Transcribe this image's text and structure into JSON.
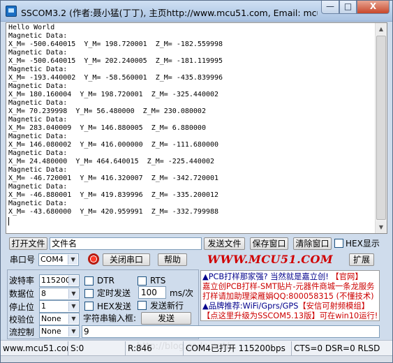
{
  "window": {
    "title": "SSCOM3.2 (作者:聂小猛(丁丁), 主页http://www.mcu51.com, Email: mcu5",
    "minimize_label": "—",
    "maximize_label": "□",
    "close_label": "X"
  },
  "terminal": {
    "lines": [
      "Hello World",
      "Magnetic Data:",
      "X_M= -500.640015  Y_M= 198.720001  Z_M= -182.559998",
      "Magnetic Data:",
      "X_M= -500.640015  Y_M= 202.240005  Z_M= -181.119995",
      "Magnetic Data:",
      "X_M= -193.440002  Y_M= -58.560001  Z_M= -435.839996",
      "Magnetic Data:",
      "X_M= 180.160004  Y_M= 198.720001  Z_M= -325.440002",
      "Magnetic Data:",
      "X_M= 70.239998  Y_M= 56.480000  Z_M= 230.080002",
      "Magnetic Data:",
      "X_M= 283.040009  Y_M= 146.880005  Z_M= 6.880000",
      "Magnetic Data:",
      "X_M= 146.080002  Y_M= 416.000000  Z_M= -111.680000",
      "Magnetic Data:",
      "X_M= 24.480000  Y_M= 464.640015  Z_M= -225.440002",
      "Magnetic Data:",
      "X_M= -46.720001  Y_M= 416.320007  Z_M= -342.720001",
      "Magnetic Data:",
      "X_M= -46.880001  Y_M= 419.839996  Z_M= -335.200012",
      "Magnetic Data:",
      "X_M= -43.680000  Y_M= 420.959991  Z_M= -332.799988"
    ]
  },
  "file_row": {
    "open_file": "打开文件",
    "file_name_value": "文件名",
    "send_file": "发送文件",
    "save_window": "保存窗口",
    "clear_window": "清除窗口",
    "hex_display": "HEX显示"
  },
  "port_row": {
    "port_label": "串口号",
    "port_value": "COM4",
    "close_port": "关闭串口",
    "help": "帮助",
    "site": "WWW.MCU51.COM",
    "expand": "扩展"
  },
  "settings": {
    "baud_label": "波特率",
    "baud_value": "115200",
    "data_bits_label": "数据位",
    "data_bits_value": "8",
    "stop_bits_label": "停止位",
    "stop_bits_value": "1",
    "parity_label": "校验位",
    "parity_value": "None",
    "flow_label": "流控制",
    "flow_value": "None",
    "dtr": "DTR",
    "rts": "RTS",
    "timed_send": "定时发送",
    "interval_value": "100",
    "interval_unit": "ms/次",
    "hex_send": "HEX发送",
    "send_newline": "发送新行",
    "input_label": "字符串输入框:",
    "send_button": "发送",
    "input_value": "9"
  },
  "ad": {
    "line1_a": "▲PCB打样那家强? 当然就是嘉立创! ",
    "line1_b": "【官网】",
    "line2": "嘉立创PCB打样-SMT贴片-元器件商城一条龙服务",
    "line3": "打样请加助理梁雁娟QQ:800058315 (不懂技术)",
    "line4_a": "▲品牌推荐:WiFi/Gprs/GPS",
    "line4_b": "【安信可射频模组】",
    "line5": "【点这里升级为SSCOM5.13版】可在win10运行!"
  },
  "status": {
    "site": "www.mcu51.cor",
    "sent": "S:0",
    "received": "R:846",
    "port_state": "COM4已打开  115200bps",
    "line_state": "CTS=0 DSR=0 RLSD",
    "watermark": "http://blog.csdn.net/"
  },
  "colors": {
    "ad_red": "#cc0000",
    "ad_blue": "#00008b",
    "site_red": "#d00000"
  }
}
